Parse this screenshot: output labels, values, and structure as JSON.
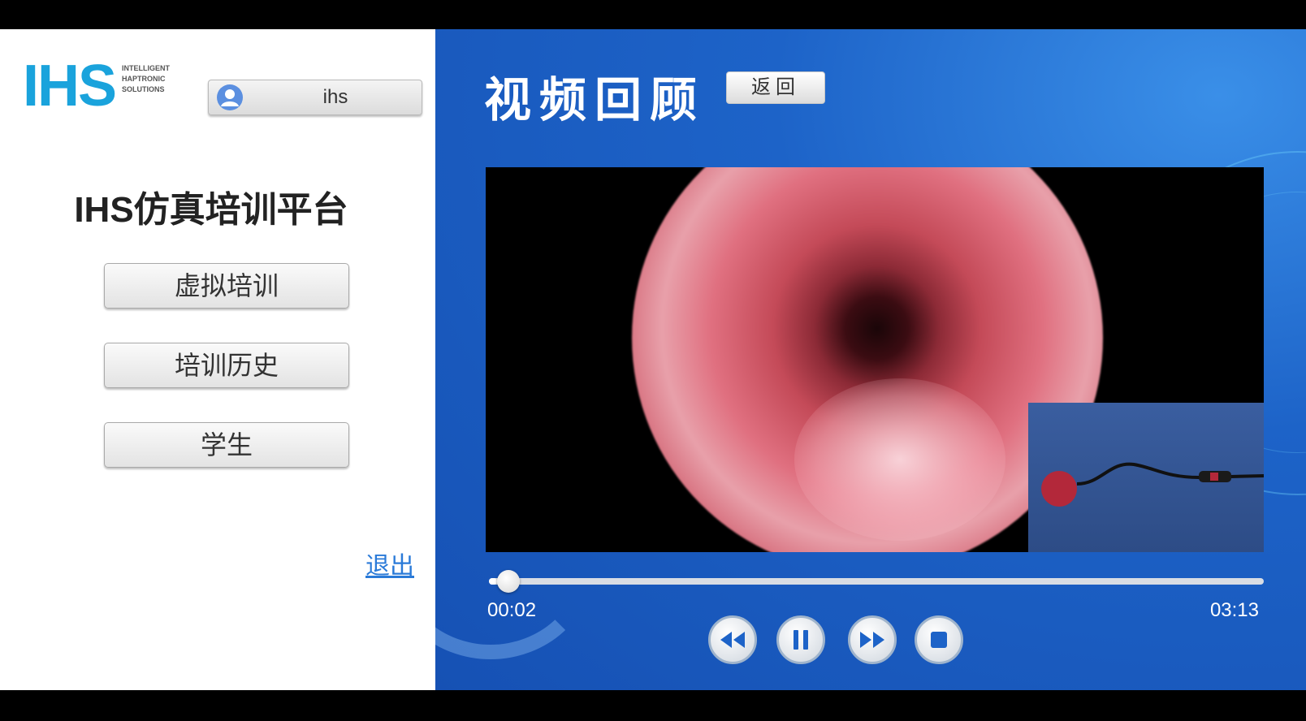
{
  "logo": {
    "mark": "IHS",
    "subtitle_lines": [
      "INTELLIGENT",
      "HAPTRONIC",
      "SOLUTIONS"
    ]
  },
  "user": {
    "name": "ihs",
    "icon": "user-avatar-icon"
  },
  "platform_title": "IHS仿真培训平台",
  "menu": {
    "items": [
      {
        "label": "虚拟培训"
      },
      {
        "label": "培训历史"
      },
      {
        "label": "学生"
      }
    ],
    "exit_label": "退出"
  },
  "page": {
    "title": "视频回顾",
    "back_label": "返回"
  },
  "player": {
    "current_time": "00:02",
    "total_time": "03:13",
    "progress_fraction": 0.01,
    "controls": [
      "rewind-icon",
      "pause-icon",
      "fast-forward-icon",
      "stop-icon"
    ]
  },
  "colors": {
    "brand_blue": "#1aa3dc",
    "panel_blue": "#1d63c8",
    "link_blue": "#2a7ad8"
  }
}
